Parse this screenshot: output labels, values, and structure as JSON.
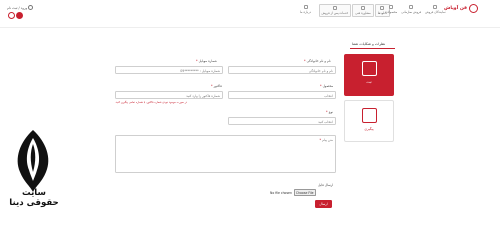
{
  "header": {
    "login_label": "ورود / ثبت نام",
    "brand": "فن آوپاش",
    "nav_items": [
      {
        "label": "محصولات",
        "icon": "grid-icon"
      },
      {
        "label": "فروش سازمانی",
        "icon": "building-icon"
      },
      {
        "label": "نمایندگان فروش",
        "icon": "shop-icon"
      },
      {
        "label": "خدمات پس از فروش",
        "icon": "support-icon"
      },
      {
        "label": "مشاوره فنی",
        "icon": "info-icon"
      },
      {
        "label": "دانلودها",
        "icon": "download-icon"
      },
      {
        "label": "درباره ما",
        "icon": "about-icon"
      }
    ]
  },
  "section": {
    "title": "نظرات و شکایات شما"
  },
  "cards": [
    {
      "label": "ثبت",
      "icon": "clipboard-icon",
      "active": true
    },
    {
      "label": "پیگیری",
      "icon": "tracking-icon",
      "active": false
    }
  ],
  "form": {
    "name_label": "نام و نام خانوادگی",
    "name_placeholder": "نام و نام خانوادگی",
    "mobile_label": "شماره موبایل",
    "mobile_placeholder": "شماره موبایل : *********09",
    "product_label": "محصول",
    "product_placeholder": "انتخاب",
    "invoice_label": "فاکتور",
    "invoice_placeholder": "شماره فاکتور را وارد کنید",
    "invoice_hint": "در صورت موجود نبودن شماره فاکتور، با شماره تماس پیگیری کنید.",
    "type_label": "نوع",
    "type_placeholder": "انتخاب کنید",
    "message_label": "متن پیام",
    "file_label": "ارسال فایل",
    "file_button": "Choose File",
    "file_status": "No file chosen",
    "submit_label": "ارسال"
  },
  "watermark": {
    "text": "سایت حقوقی دینا"
  },
  "colors": {
    "accent": "#c8202f"
  }
}
